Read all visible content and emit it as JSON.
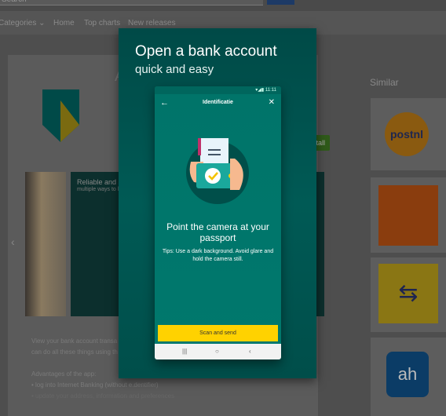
{
  "header": {
    "search_placeholder": "Search"
  },
  "nav": {
    "categories": "Categories ⌄",
    "items": [
      "Home",
      "Top charts",
      "New releases"
    ]
  },
  "app": {
    "title_initial": "A",
    "install_label": "Install"
  },
  "carousel": {
    "shot_title": "Reliable and saf",
    "shot_sub": "multiple ways to lo"
  },
  "description": [
    "View your bank account transa",
    "can do all these things using th",
    "",
    "Advantages of the app:",
    "• log into Internet Banking (without e.dentifier)",
    "• update your address, information and preferences"
  ],
  "similar": {
    "title": "Similar",
    "apps": [
      "PostNL",
      "ING",
      "NS",
      "Albert Heijn"
    ]
  },
  "modal": {
    "title": "Open a bank account",
    "subtitle": "quick and easy",
    "phone": {
      "time": "11:11",
      "screen_title": "Identificatie",
      "heading": "Point the camera at your passport",
      "tips": "Tips: Use a dark background. Avoid glare and hold the camera still.",
      "button": "Scan and send"
    }
  },
  "colors": {
    "modal_bg": "#004d4a",
    "phone_bg": "#00786d",
    "button": "#ffd200",
    "abn_green": "#005e5d",
    "abn_yellow": "#f0b400"
  }
}
